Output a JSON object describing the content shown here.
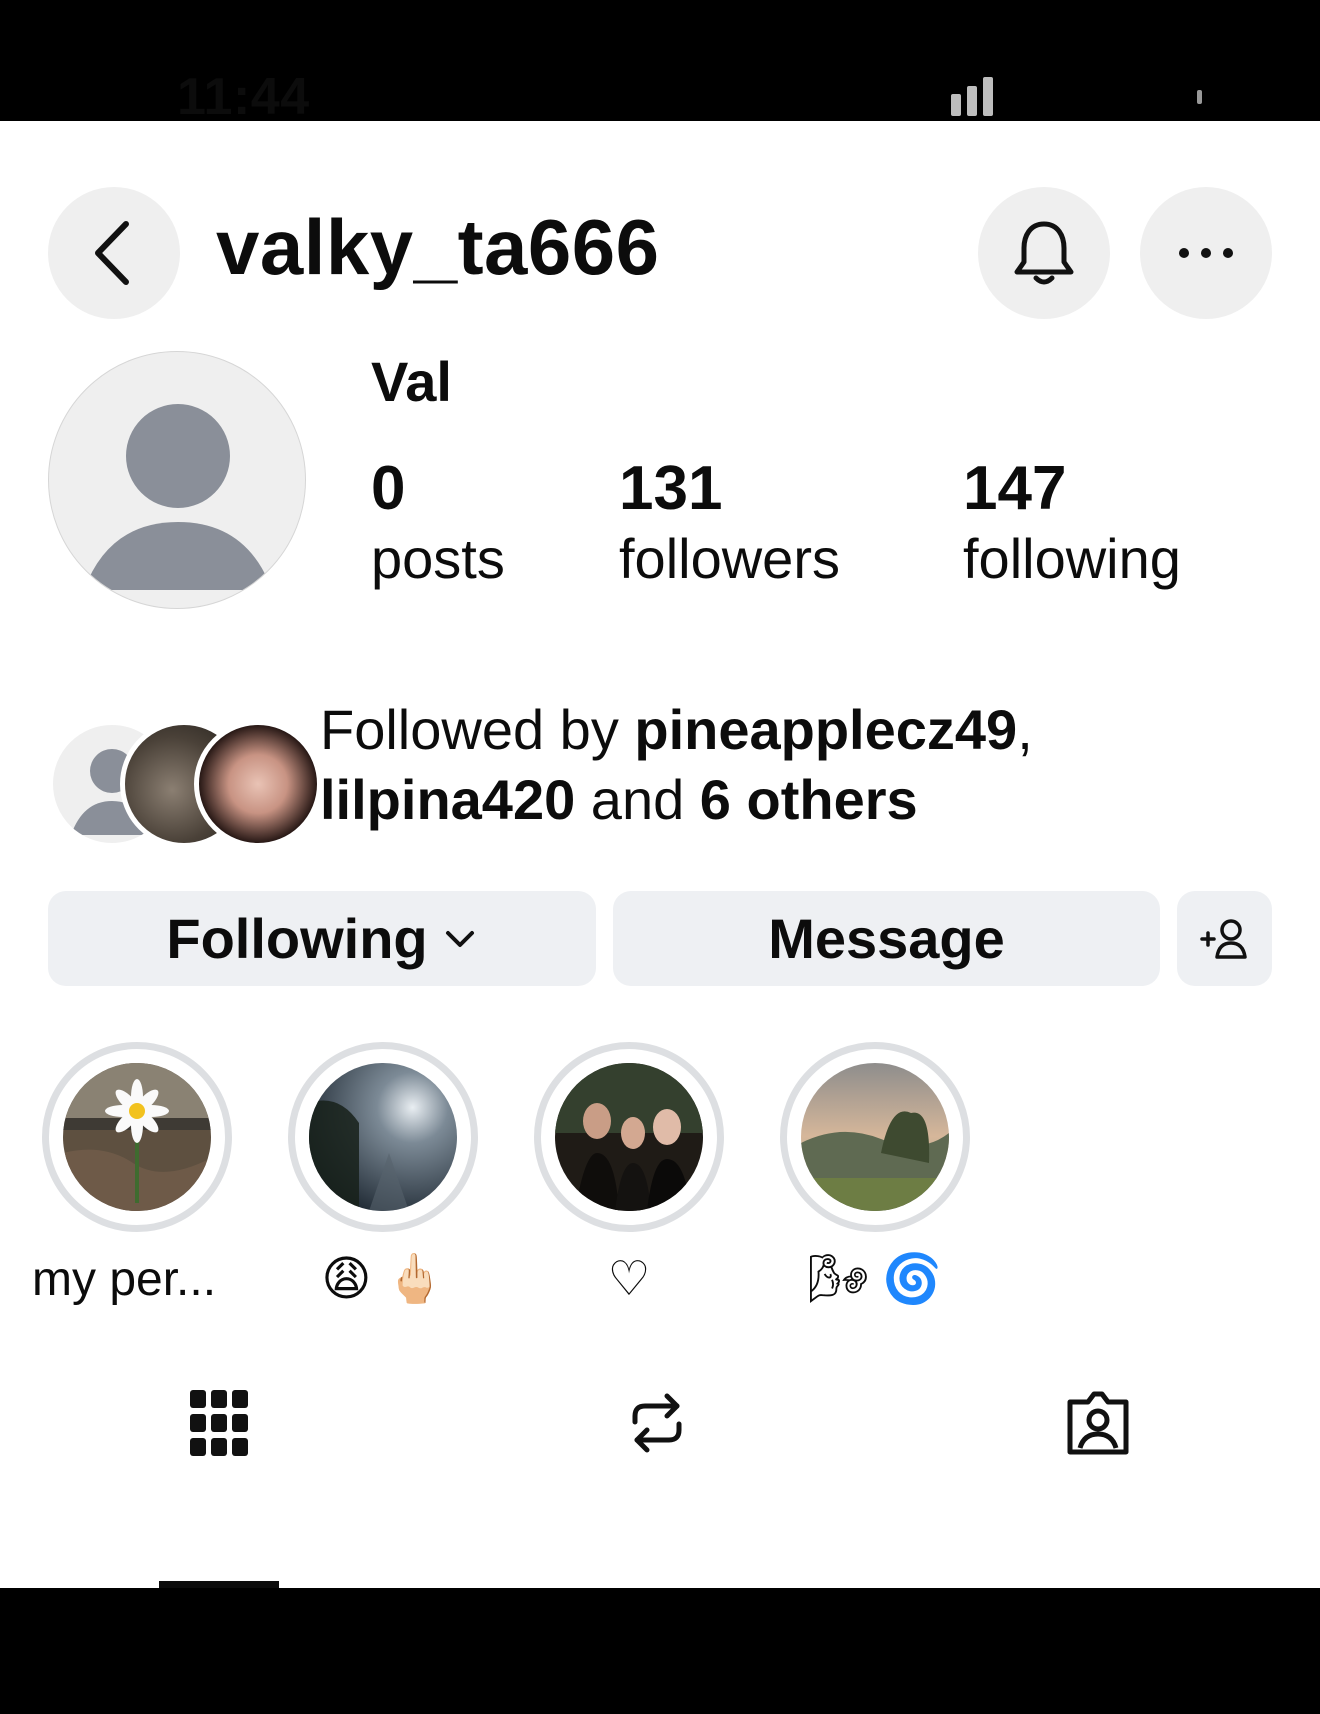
{
  "status_bar": {
    "time": "11:44"
  },
  "header": {
    "username": "valky_ta666",
    "back_icon": "chevron-left-icon",
    "bell_icon": "bell-icon",
    "more_icon": "more-horizontal-icon"
  },
  "profile": {
    "display_name": "Val",
    "stats": [
      {
        "count": "0",
        "label": "posts"
      },
      {
        "count": "131",
        "label": "followers"
      },
      {
        "count": "147",
        "label": "following"
      }
    ]
  },
  "followed_by": {
    "prefix": "Followed by ",
    "user1": "pineapplecz49",
    "sep": ",",
    "user2": "lilpina420",
    "mid": " and ",
    "others": "6 others"
  },
  "actions": {
    "following_label": "Following",
    "message_label": "Message",
    "add_user_icon": "add-user-icon"
  },
  "highlights": [
    {
      "label": "my per..."
    },
    {
      "label": "😩 🖕🏻"
    },
    {
      "label": "♡"
    },
    {
      "label": "🌬 🌀"
    }
  ],
  "tabs": [
    {
      "name": "grid-icon"
    },
    {
      "name": "reposts-icon"
    },
    {
      "name": "tagged-icon"
    }
  ]
}
